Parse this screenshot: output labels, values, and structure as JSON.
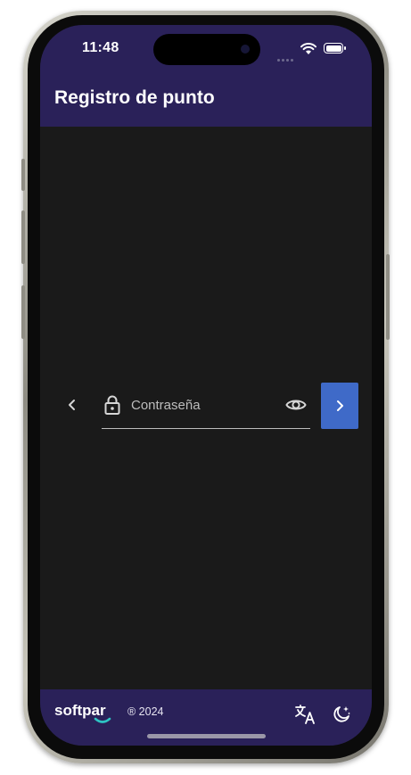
{
  "status_bar": {
    "time": "11:48"
  },
  "app_bar": {
    "title": "Registro de punto"
  },
  "login": {
    "password_placeholder": "Contraseña",
    "password_value": ""
  },
  "footer": {
    "brand": "softpar",
    "copyright": "® 2024"
  },
  "icons": {
    "back": "chevron-left-icon",
    "lock": "lock-icon",
    "visibility": "eye-icon",
    "next": "chevron-right-icon",
    "translate": "translate-icon",
    "theme": "moon-stars-icon"
  },
  "colors": {
    "app_bar": "#2a2159",
    "background": "#1a1a1a",
    "accent": "#3f6ac8",
    "logo_accent": "#2ec4c4"
  }
}
